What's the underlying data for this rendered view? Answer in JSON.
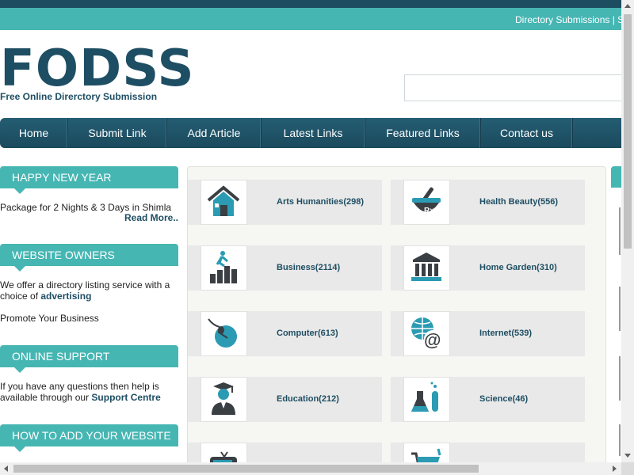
{
  "header": {
    "top_links": "Directory Submissions | S",
    "logo": "FODSS",
    "tagline": "Free Online Direrctory Submission",
    "search_placeholder": ""
  },
  "nav": [
    {
      "label": "Home"
    },
    {
      "label": "Submit Link"
    },
    {
      "label": "Add Article"
    },
    {
      "label": "Latest Links"
    },
    {
      "label": "Featured Links"
    },
    {
      "label": "Contact us"
    }
  ],
  "sidebar": {
    "new_year": {
      "heading": "HAPPY NEW YEAR",
      "text": "Package for 2 Nights & 3 Days in Shimla",
      "read_more": "Read More.."
    },
    "website_owners": {
      "heading": "WEBSITE OWNERS",
      "text_pre": "We offer a directory listing service with a choice of ",
      "text_bold": "advertising",
      "promote": "Promote Your Business"
    },
    "online_support": {
      "heading": "ONLINE SUPPORT",
      "text_pre": "If you have any questions then help is available through our ",
      "text_bold": "Support Centre"
    },
    "how_to": {
      "heading": "HOW TO ADD YOUR WEBSITE"
    }
  },
  "categories": [
    {
      "name": "Arts Humanities",
      "count": "(298)",
      "icon": "house-icon"
    },
    {
      "name": "Health Beauty",
      "count": "(556)",
      "icon": "mortar-pestle-icon"
    },
    {
      "name": "Business",
      "count": "(2114)",
      "icon": "business-growth-icon"
    },
    {
      "name": "Home Garden",
      "count": "(310)",
      "icon": "building-columns-icon"
    },
    {
      "name": "Computer",
      "count": "(613)",
      "icon": "mouse-icon"
    },
    {
      "name": "Internet",
      "count": "(539)",
      "icon": "globe-at-icon"
    },
    {
      "name": "Education",
      "count": "(212)",
      "icon": "graduate-icon"
    },
    {
      "name": "Science",
      "count": "(46)",
      "icon": "flask-icon"
    },
    {
      "name": "",
      "count": "",
      "icon": "tv-icon"
    },
    {
      "name": "",
      "count": "",
      "icon": "shopping-cart-icon"
    }
  ],
  "colors": {
    "brand_dark": "#1e4e63",
    "accent_teal": "#46b6b3",
    "nav_bg": "#215569"
  }
}
